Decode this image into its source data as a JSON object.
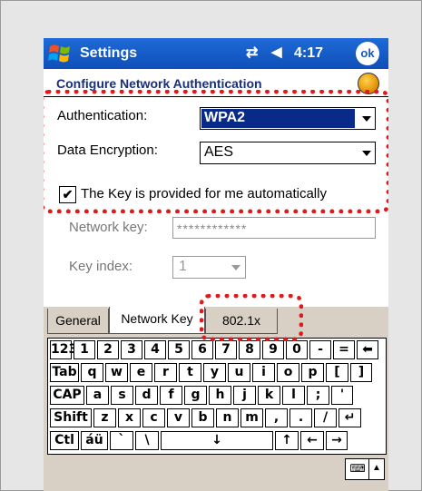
{
  "titlebar": {
    "title": "Settings",
    "clock": "4:17",
    "ok_label": "ok",
    "connectivity_icon": "connectivity-icon",
    "volume_icon": "speaker-icon"
  },
  "header": {
    "title": "Configure Network Authentication"
  },
  "form": {
    "authentication_label": "Authentication:",
    "authentication_value": "WPA2",
    "encryption_label": "Data Encryption:",
    "encryption_value": "AES",
    "auto_key_checked": true,
    "auto_key_label": "The Key is provided for me automatically",
    "network_key_label": "Network key:",
    "network_key_value": "************",
    "key_index_label": "Key index:",
    "key_index_value": "1"
  },
  "tabs": [
    {
      "label": "General",
      "active": false
    },
    {
      "label": "Network Key",
      "active": true
    },
    {
      "label": "802.1x",
      "active": false
    }
  ],
  "keyboard": {
    "rows": [
      [
        "123",
        "1",
        "2",
        "3",
        "4",
        "5",
        "6",
        "7",
        "8",
        "9",
        "0",
        "-",
        "=",
        "⬅"
      ],
      [
        "Tab",
        "q",
        "w",
        "e",
        "r",
        "t",
        "y",
        "u",
        "i",
        "o",
        "p",
        "[",
        "]"
      ],
      [
        "CAP",
        "a",
        "s",
        "d",
        "f",
        "g",
        "h",
        "j",
        "k",
        "l",
        ";",
        "'"
      ],
      [
        "Shift",
        "z",
        "x",
        "c",
        "v",
        "b",
        "n",
        "m",
        ",",
        ".",
        "/",
        "↵"
      ],
      [
        "Ctl",
        "áü",
        "`",
        "\\",
        "↓",
        "↑",
        "←",
        "→"
      ]
    ]
  },
  "colors": {
    "titlebar": "#1456c4",
    "annotation": "#e01a1a",
    "selection": "#0a2a8a"
  }
}
